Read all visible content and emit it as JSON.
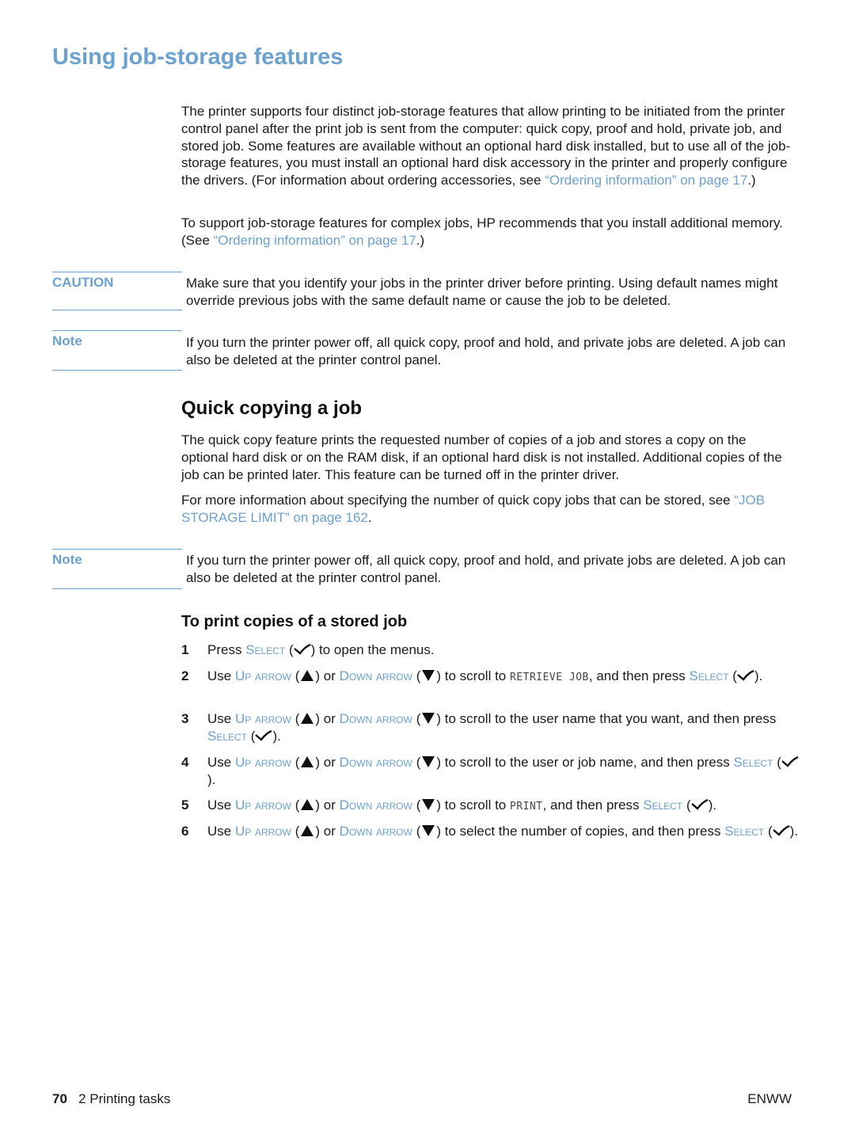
{
  "page_title": "Using job-storage features",
  "intro": {
    "p1_text": "The printer supports four distinct job-storage features that allow printing to be initiated from the printer control panel after the print job is sent from the computer: quick copy, proof and hold, private job, and stored job. Some features are available without an optional hard disk installed, but to use all of the job-storage features, you must install an optional hard disk accessory in the printer and properly configure the drivers. (For information about ordering accessories, see ",
    "p1_link": "“Ordering information” on page 17",
    "p1_end": ".)",
    "p2_text": "To support job-storage features for complex jobs, HP recommends that you install additional memory. (See ",
    "p2_link": "“Ordering information” on page 17",
    "p2_end": ".)"
  },
  "caution": {
    "label": "CAUTION",
    "text": "Make sure that you identify your jobs in the printer driver before printing. Using default names might override previous jobs with the same default name or cause the job to be deleted."
  },
  "note1": {
    "label": "Note",
    "text": "If you turn the printer power off, all quick copy, proof and hold, and private jobs are deleted. A job can also be deleted at the printer control panel."
  },
  "quick_copy": {
    "heading": "Quick copying a job",
    "p1": "The quick copy feature prints the requested number of copies of a job and stores a copy on the optional hard disk or on the RAM disk, if an optional hard disk is not installed. Additional copies of the job can be printed later. This feature can be turned off in the printer driver.",
    "p2_text": "For more information about specifying the number of quick copy jobs that can be stored, see ",
    "p2_link": "“JOB STORAGE LIMIT” on page 162",
    "p2_end": "."
  },
  "note2": {
    "label": "Note",
    "text": "If you turn the printer power off, all quick copy, proof and hold, and private jobs are deleted. A job can also be deleted at the printer control panel."
  },
  "procedure": {
    "heading": "To print copies of a stored job",
    "keys": {
      "select": "Select",
      "up_arrow": "Up arrow",
      "down_arrow": "Down arrow"
    },
    "words": {
      "press": "Press",
      "use": "Use",
      "or": "or"
    },
    "steps": [
      {
        "num": "1",
        "after_select": " to open the menus."
      },
      {
        "num": "2",
        "middle": " to scroll to ",
        "display": "RETRIEVE JOB",
        "after_display": ", and then press "
      },
      {
        "num": "3",
        "middle": " to scroll to the user name that you want, and then press "
      },
      {
        "num": "4",
        "middle": " to scroll to the user or job name, and then press "
      },
      {
        "num": "5",
        "middle": " to scroll to ",
        "display": "PRINT",
        "after_display": ", and then press "
      },
      {
        "num": "6",
        "middle": " to select the number of copies, and then press "
      }
    ],
    "end": ".",
    "close_paren": ")",
    "open_paren": "("
  },
  "footer": {
    "page_number": "70",
    "chapter": "2 Printing tasks",
    "edition": "ENWW"
  }
}
